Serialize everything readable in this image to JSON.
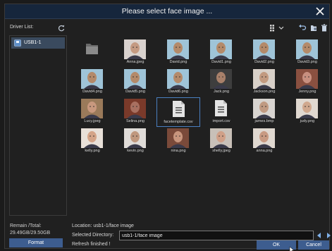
{
  "dialog": {
    "title": "Please select face image ...",
    "close_icon": "close-icon"
  },
  "sidebar": {
    "driver_list_label": "Driver List:",
    "drivers": [
      {
        "label": "USB1-1",
        "icon": "usb-drive-icon"
      }
    ],
    "remain_label": "Remain /Total:",
    "remain_value": "29.49GB/29.50GB",
    "format_label": "Format"
  },
  "toolbar": {
    "icons": [
      "grid-view-icon",
      "chevron-down-icon",
      "back-arrow-icon",
      "new-folder-icon",
      "delete-icon"
    ]
  },
  "files": [
    {
      "name": "",
      "type": "folder"
    },
    {
      "name": "Anna.jpeg",
      "type": "image",
      "color": "#c49a82",
      "bg": "#d9d2ce"
    },
    {
      "name": "David.png",
      "type": "image",
      "color": "#b48a6a",
      "bg": "#9fc4d8"
    },
    {
      "name": "David1.png",
      "type": "image",
      "color": "#b48a6a",
      "bg": "#9fc4d8"
    },
    {
      "name": "David2.png",
      "type": "image",
      "color": "#b48a6a",
      "bg": "#9fc4d8"
    },
    {
      "name": "David3.png",
      "type": "image",
      "color": "#b48a6a",
      "bg": "#9fc4d8"
    },
    {
      "name": "David4.png",
      "type": "image",
      "color": "#b48a6a",
      "bg": "#9fc4d8"
    },
    {
      "name": "David5.png",
      "type": "image",
      "color": "#b48a6a",
      "bg": "#9fc4d8"
    },
    {
      "name": "David6.png",
      "type": "image",
      "color": "#b48a6a",
      "bg": "#9fc4d8"
    },
    {
      "name": "Jack.png",
      "type": "image",
      "color": "#a8806a",
      "bg": "#3e3e3e"
    },
    {
      "name": "Jackson.png",
      "type": "image",
      "color": "#c29a80",
      "bg": "#d8d0c8"
    },
    {
      "name": "Jenny.png",
      "type": "image",
      "color": "#c89080",
      "bg": "#8a5040"
    },
    {
      "name": "Lucy.jpeg",
      "type": "image",
      "color": "#c8987e",
      "bg": "#9a7a5a"
    },
    {
      "name": "Selina.png",
      "type": "image",
      "color": "#a87060",
      "bg": "#7a3a2a"
    },
    {
      "name": "facetemplate.csv",
      "type": "document",
      "selected": true
    },
    {
      "name": "import.csv",
      "type": "document"
    },
    {
      "name": "james.bmp",
      "type": "image",
      "color": "#c09a82",
      "bg": "#d8d4d0"
    },
    {
      "name": "judy.png",
      "type": "image",
      "color": "#d0a88e",
      "bg": "#e0d8d0"
    },
    {
      "name": "kelly.png",
      "type": "image",
      "color": "#d4a488",
      "bg": "#e8e0d8"
    },
    {
      "name": "kevin.png",
      "type": "image",
      "color": "#c0987e",
      "bg": "#e0dcd8"
    },
    {
      "name": "nina.png",
      "type": "image",
      "color": "#c8967e",
      "bg": "#7a4a3a"
    },
    {
      "name": "shelly.jpeg",
      "type": "image",
      "color": "#d0a088",
      "bg": "#c8c0b8"
    },
    {
      "name": "anna.png",
      "type": "image",
      "color": "#c89a82",
      "bg": "#e0d8d0"
    }
  ],
  "footer": {
    "location": "Location: usb1-1/face image",
    "selected_directory_label": "Selected Directory:",
    "selected_directory_value": "usb1-1/face image",
    "status": "Refresh finished !",
    "ok_label": "OK",
    "cancel_label": "Cancel"
  }
}
